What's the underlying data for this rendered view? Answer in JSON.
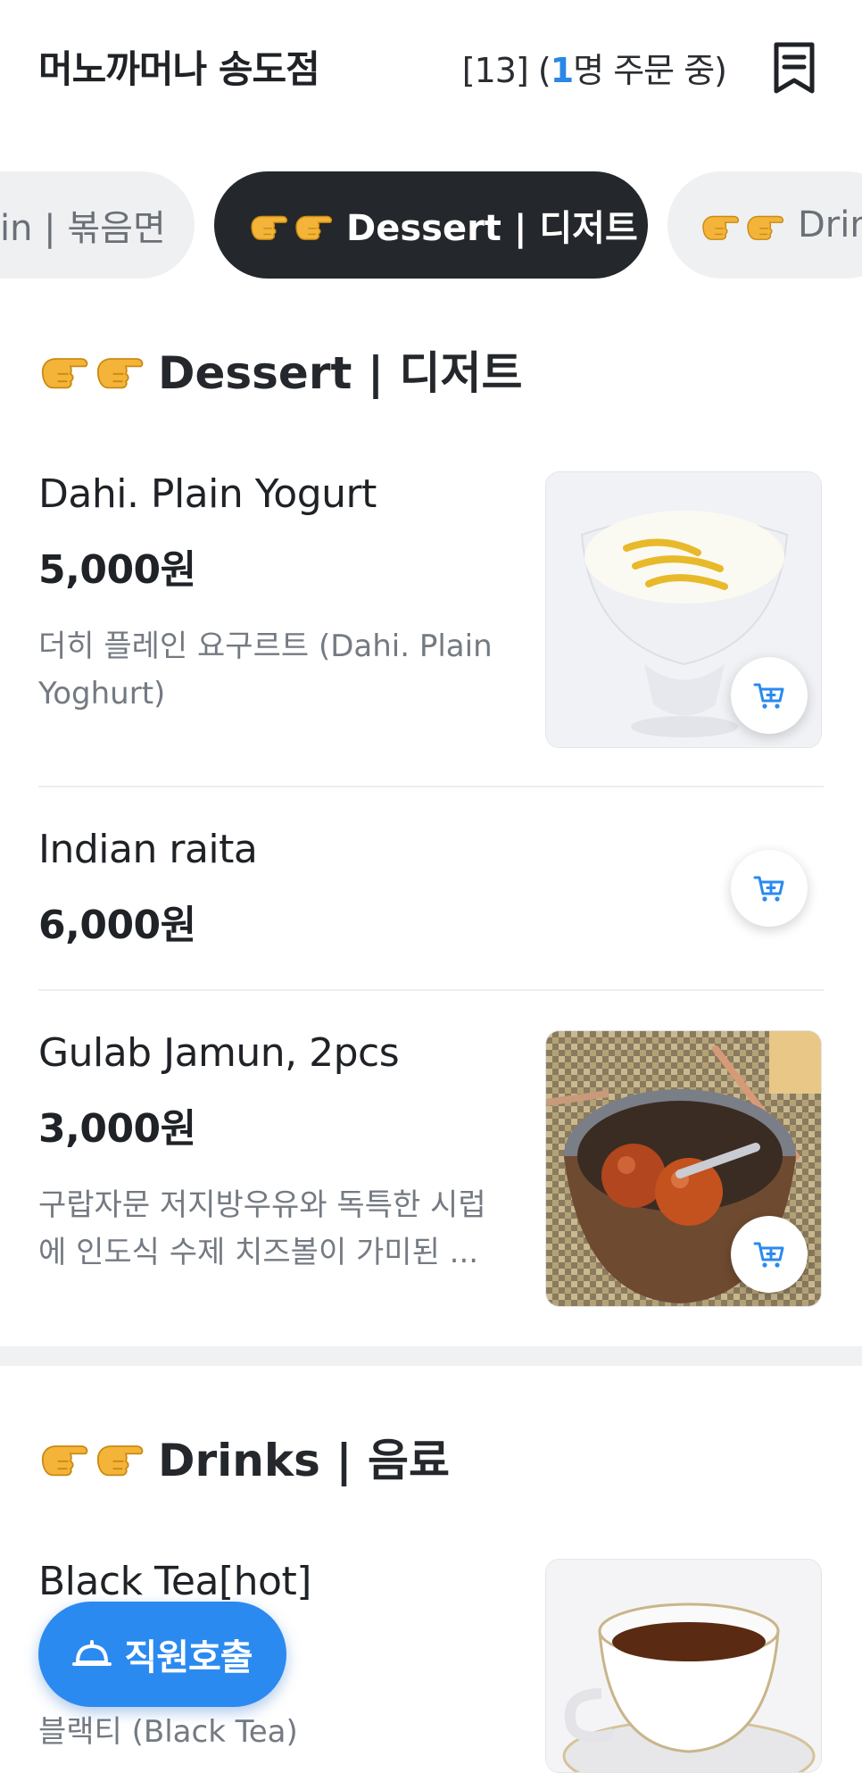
{
  "header": {
    "store_name": "머노까머나 송도점",
    "table_prefix": "[13] (",
    "order_count": "1",
    "order_suffix": "명 주문 중)"
  },
  "tabs": [
    {
      "label": "in | 볶음면",
      "active": false
    },
    {
      "label": "Dessert | 디저트",
      "active": true
    },
    {
      "label": "Drin",
      "active": false
    }
  ],
  "sections": {
    "dessert": {
      "title": "Dessert | 디저트",
      "items": [
        {
          "name": "Dahi. Plain Yogurt",
          "price": "5,000원",
          "desc": "더히 플레인 요구르트 (Dahi. Plain Yoghurt)"
        },
        {
          "name": "Indian raita",
          "price": "6,000원"
        },
        {
          "name": "Gulab Jamun, 2pcs",
          "price": "3,000원",
          "desc": "구랍자문 저지방우유와 독특한 시럽에 인도식 수제 치즈볼이 가미된 ..."
        }
      ]
    },
    "drinks": {
      "title": "Drinks | 음료",
      "items": [
        {
          "name": "Black Tea[hot]",
          "desc": "블랙티 (Black Tea)"
        }
      ]
    }
  },
  "staff_call": {
    "label": "직원호출"
  },
  "colors": {
    "accent": "#2b8af0",
    "active_tab": "#24272b",
    "inactive_tab": "#eff0f2"
  }
}
